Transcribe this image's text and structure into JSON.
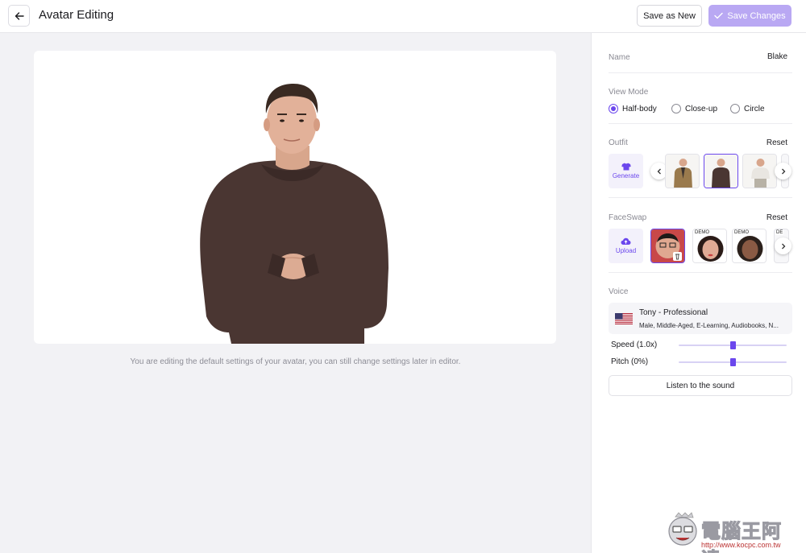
{
  "header": {
    "title": "Avatar Editing",
    "save_as_new": "Save as New",
    "save_changes": "Save Changes"
  },
  "main": {
    "hint": "You are editing the default settings of your avatar, you can still change settings later in editor."
  },
  "panel": {
    "name_label": "Name",
    "name_value": "Blake",
    "view_mode": {
      "label": "View Mode",
      "options": [
        "Half-body",
        "Close-up",
        "Circle"
      ],
      "selected": "Half-body"
    },
    "outfit": {
      "label": "Outfit",
      "reset": "Reset",
      "generate": "Generate"
    },
    "faceswap": {
      "label": "FaceSwap",
      "reset": "Reset",
      "upload": "Upload",
      "demo_tags": [
        "DEMO",
        "DEMO",
        "DE"
      ]
    },
    "voice": {
      "label": "Voice",
      "name": "Tony - Professional",
      "description": "Male, Middle-Aged, E-Learning, Audiobooks, N...",
      "speed_label": "Speed (1.0x)",
      "pitch_label": "Pitch (0%)",
      "speed_level": 0.5,
      "pitch_level": 0.5,
      "listen": "Listen to the sound"
    }
  },
  "watermark": {
    "title": "電腦王阿達",
    "url": "http://www.kocpc.com.tw"
  },
  "colors": {
    "accent": "#6b47ed",
    "accent_light": "#b9a8f3",
    "sweater": "#4a3632"
  }
}
